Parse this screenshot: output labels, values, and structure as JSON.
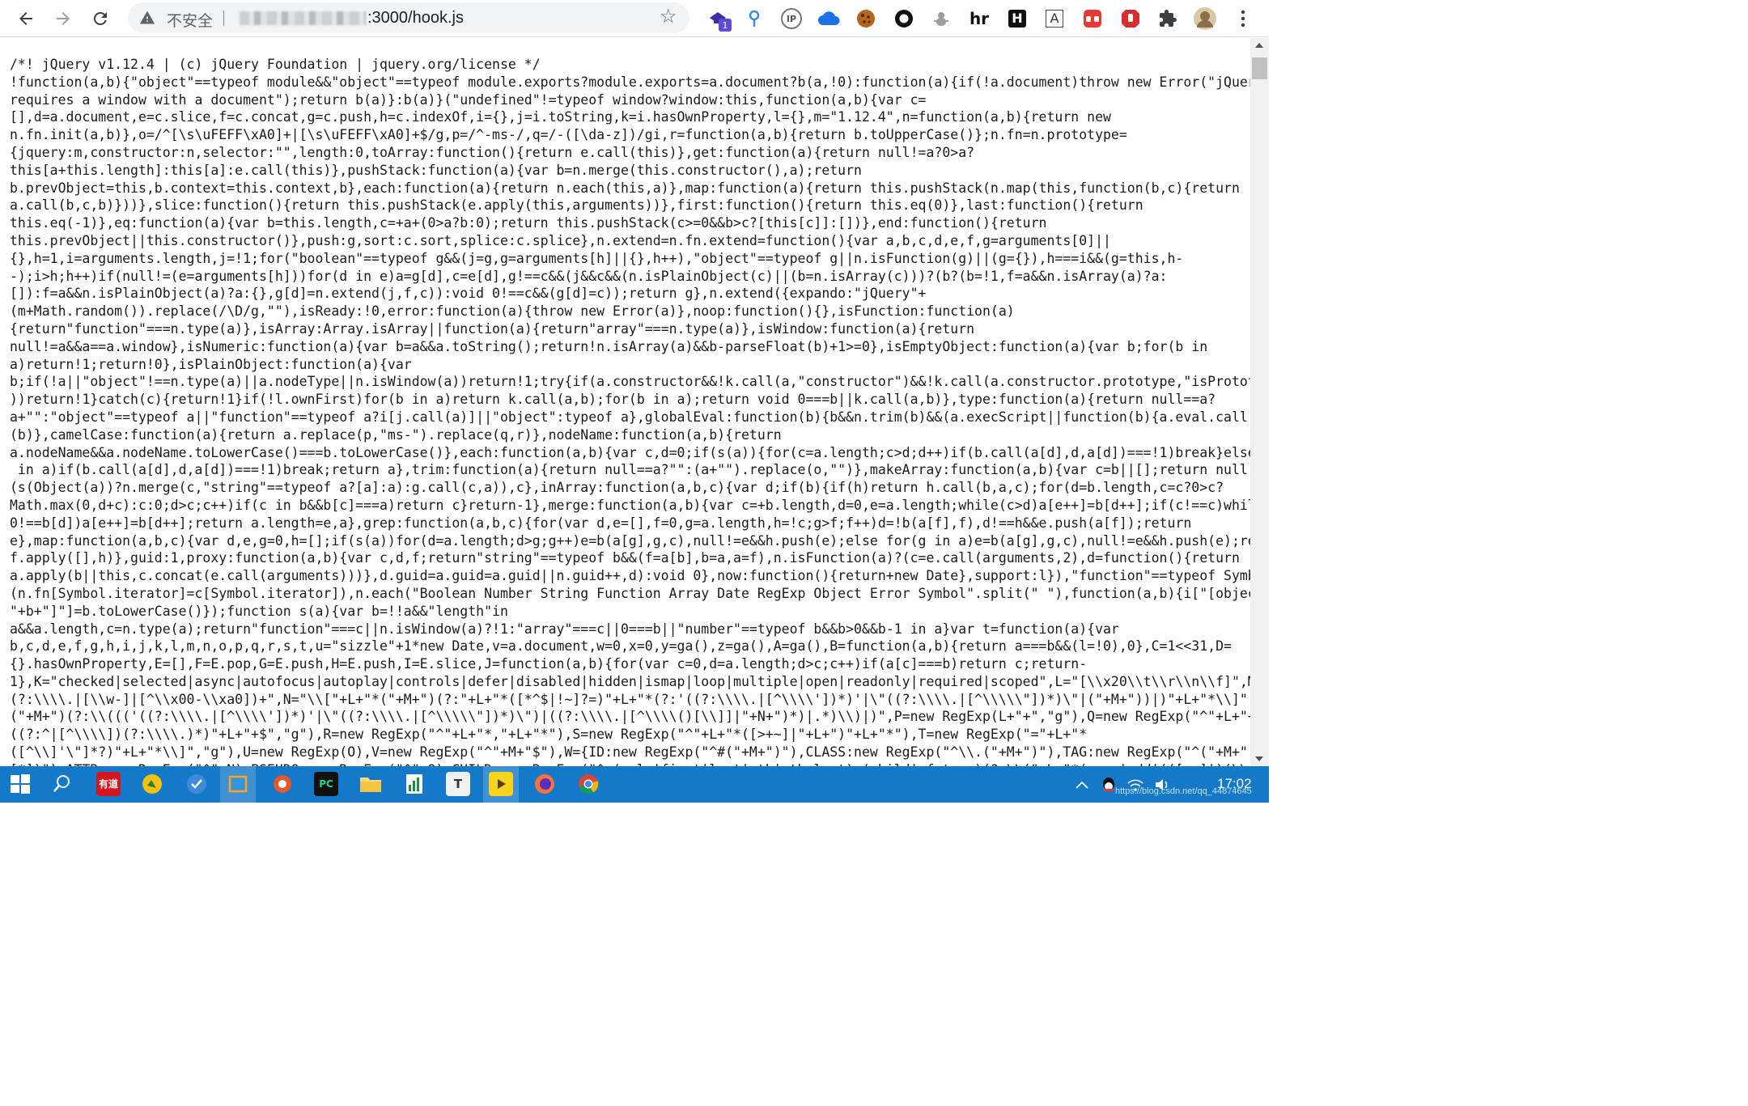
{
  "browser": {
    "security_text": "不安全",
    "url_visible": ":3000/hook.js",
    "ext_badge_count": "1",
    "ext_hr_label": "hr",
    "ext_h_label": "H",
    "ext_a_label": "A",
    "ext_ip_label": "IP"
  },
  "code_lines": [
    "/*! jQuery v1.12.4 | (c) jQuery Foundation | jquery.org/license */",
    "!function(a,b){\"object\"==typeof module&&\"object\"==typeof module.exports?module.exports=a.document?b(a,!0):function(a){if(!a.document)throw new Error(\"jQuery",
    "requires a window with a document\");return b(a)}:b(a)}(\"undefined\"!=typeof window?window:this,function(a,b){var c=",
    "[],d=a.document,e=c.slice,f=c.concat,g=c.push,h=c.indexOf,i={},j=i.toString,k=i.hasOwnProperty,l={},m=\"1.12.4\",n=function(a,b){return new",
    "n.fn.init(a,b)},o=/^[\\s\\uFEFF\\xA0]+|[\\s\\uFEFF\\xA0]+$/g,p=/^-ms-/,q=/-([\\da-z])/gi,r=function(a,b){return b.toUpperCase()};n.fn=n.prototype=",
    "{jquery:m,constructor:n,selector:\"\",length:0,toArray:function(){return e.call(this)},get:function(a){return null!=a?0>a?",
    "this[a+this.length]:this[a]:e.call(this)},pushStack:function(a){var b=n.merge(this.constructor(),a);return",
    "b.prevObject=this,b.context=this.context,b},each:function(a){return n.each(this,a)},map:function(a){return this.pushStack(n.map(this,function(b,c){return",
    "a.call(b,c,b)}))},slice:function(){return this.pushStack(e.apply(this,arguments))},first:function(){return this.eq(0)},last:function(){return",
    "this.eq(-1)},eq:function(a){var b=this.length,c=+a+(0>a?b:0);return this.pushStack(c>=0&&b>c?[this[c]]:[])},end:function(){return",
    "this.prevObject||this.constructor()},push:g,sort:c.sort,splice:c.splice},n.extend=n.fn.extend=function(){var a,b,c,d,e,f,g=arguments[0]||",
    "{},h=1,i=arguments.length,j=!1;for(\"boolean\"==typeof g&&(j=g,g=arguments[h]||{},h++),\"object\"==typeof g||n.isFunction(g)||(g={}),h===i&&(g=this,h-",
    "-);i>h;h++)if(null!=(e=arguments[h]))for(d in e)a=g[d],c=e[d],g!==c&&(j&&c&&(n.isPlainObject(c)||(b=n.isArray(c)))?(b?(b=!1,f=a&&n.isArray(a)?a:",
    "[]):f=a&&n.isPlainObject(a)?a:{},g[d]=n.extend(j,f,c)):void 0!==c&&(g[d]=c));return g},n.extend({expando:\"jQuery\"+",
    "(m+Math.random()).replace(/\\D/g,\"\"),isReady:!0,error:function(a){throw new Error(a)},noop:function(){},isFunction:function(a)",
    "{return\"function\"===n.type(a)},isArray:Array.isArray||function(a){return\"array\"===n.type(a)},isWindow:function(a){return",
    "null!=a&&a==a.window},isNumeric:function(a){var b=a&&a.toString();return!n.isArray(a)&&b-parseFloat(b)+1>=0},isEmptyObject:function(a){var b;for(b in",
    "a)return!1;return!0},isPlainObject:function(a){var",
    "b;if(!a||\"object\"!==n.type(a)||a.nodeType||n.isWindow(a))return!1;try{if(a.constructor&&!k.call(a,\"constructor\")&&!k.call(a.constructor.prototype,\"isPrototypeOf\"",
    "))return!1}catch(c){return!1}if(!l.ownFirst)for(b in a)return k.call(a,b);for(b in a);return void 0===b||k.call(a,b)},type:function(a){return null==a?",
    "a+\"\":\"object\"==typeof a||\"function\"==typeof a?i[j.call(a)]||\"object\":typeof a},globalEval:function(b){b&&n.trim(b)&&(a.execScript||function(b){a.eval.call(a,b)})",
    "(b)},camelCase:function(a){return a.replace(p,\"ms-\").replace(q,r)},nodeName:function(a,b){return",
    "a.nodeName&&a.nodeName.toLowerCase()===b.toLowerCase()},each:function(a,b){var c,d=0;if(s(a)){for(c=a.length;c>d;d++)if(b.call(a[d],d,a[d])===!1)break}else for(d",
    " in a)if(b.call(a[d],d,a[d])===!1)break;return a},trim:function(a){return null==a?\"\":(a+\"\").replace(o,\"\")},makeArray:function(a,b){var c=b||[];return null!=a&&",
    "(s(Object(a))?n.merge(c,\"string\"==typeof a?[a]:a):g.call(c,a)),c},inArray:function(a,b,c){var d;if(b){if(h)return h.call(b,a,c);for(d=b.length,c=c?0>c?",
    "Math.max(0,d+c):c:0;d>c;c++)if(c in b&&b[c]===a)return c}return-1},merge:function(a,b){var c=+b.length,d=0,e=a.length;while(c>d)a[e++]=b[d++];if(c!==c)while(void",
    "0!==b[d])a[e++]=b[d++];return a.length=e,a},grep:function(a,b,c){for(var d,e=[],f=0,g=a.length,h=!c;g>f;f++)d=!b(a[f],f),d!==h&&e.push(a[f]);return",
    "e},map:function(a,b,c){var d,e,g=0,h=[];if(s(a))for(d=a.length;d>g;g++)e=b(a[g],g,c),null!=e&&h.push(e);else for(g in a)e=b(a[g],g,c),null!=e&&h.push(e);return",
    "f.apply([],h)},guid:1,proxy:function(a,b){var c,d,f;return\"string\"==typeof b&&(f=a[b],b=a,a=f),n.isFunction(a)?(c=e.call(arguments,2),d=function(){return",
    "a.apply(b||this,c.concat(e.call(arguments)))},d.guid=a.guid=a.guid||n.guid++,d):void 0},now:function(){return+new Date},support:l}),\"function\"==typeof Symbol&&",
    "(n.fn[Symbol.iterator]=c[Symbol.iterator]),n.each(\"Boolean Number String Function Array Date RegExp Object Error Symbol\".split(\" \"),function(a,b){i[\"[object",
    "\"+b+\"]\"]=b.toLowerCase()});function s(a){var b=!!a&&\"length\"in",
    "a&&a.length,c=n.type(a);return\"function\"===c||n.isWindow(a)?!1:\"array\"===c||0===b||\"number\"==typeof b&&b>0&&b-1 in a}var t=function(a){var",
    "b,c,d,e,f,g,h,i,j,k,l,m,n,o,p,q,r,s,t,u=\"sizzle\"+1*new Date,v=a.document,w=0,x=0,y=ga(),z=ga(),A=ga(),B=function(a,b){return a===b&&(l=!0),0},C=1<<31,D=",
    "{}.hasOwnProperty,E=[],F=E.pop,G=E.push,H=E.push,I=E.slice,J=function(a,b){for(var c=0,d=a.length;d>c;c++)if(a[c]===b)return c;return-",
    "1},K=\"checked|selected|async|autofocus|autoplay|controls|defer|disabled|hidden|ismap|loop|multiple|open|readonly|required|scoped\",L=\"[\\\\x20\\\\t\\\\r\\\\n\\\\f]\",M=\"",
    "(?:\\\\\\\\.|[\\\\w-]|[^\\\\x00-\\\\xa0])+\",N=\"\\\\[\"+L+\"*(\"+M+\")(?:\"+L+\"*([*^$|!~]?=)\"+L+\"*(?:'((?:\\\\\\\\.|[^\\\\\\\\'])*)'|\\\"((?:\\\\\\\\.|[^\\\\\\\\\\\"])*)\\\"|(\"+M+\"))|)\"+L+\"*\\\\]\",O=\":",
    "(\"+M+\")(?:\\\\((('((?:\\\\\\\\.|[^\\\\\\\\'])*)'|\\\"((?:\\\\\\\\.|[^\\\\\\\\\\\"])*)\\\")|((?:\\\\\\\\.|[^\\\\\\\\()[\\\\]]|\"+N+\")*)|.*)\\\\)|)\",P=new RegExp(L+\"+\",\"g\"),Q=new RegExp(\"^\"+L+\"+|",
    "((?:^|[^\\\\\\\\])(?:\\\\\\\\.)*)\"+L+\"+$\",\"g\"),R=new RegExp(\"^\"+L+\"*,\"+L+\"*\"),S=new RegExp(\"^\"+L+\"*([>+~]|\"+L+\")\"+L+\"*\"),T=new RegExp(\"=\"+L+\"*",
    "([^\\\\]'\\\"]*?)\"+L+\"*\\\\]\",\"g\"),U=new RegExp(O),V=new RegExp(\"^\"+M+\"$\"),W={ID:new RegExp(\"^#(\"+M+\")\"),CLASS:new RegExp(\"^\\\\.(\"+M+\")\"),TAG:new RegExp(\"^(\"+M+\"|",
    "[*])\"),ATTR:new RegExp(\"^\"+N),PSEUDO:new RegExp(\"^\"+O),CHILD:new RegExp(\"^:(only|first|last|nth|nth-last)-(child|of-type)(?:\\\\(\"+L+\"*(even|odd|(([+-]|)(\\\\d*)n|)\"+L+\"*"
  ],
  "taskbar": {
    "clock": "17:02",
    "watermark": "https://blog.csdn.net/qq_44874645"
  }
}
